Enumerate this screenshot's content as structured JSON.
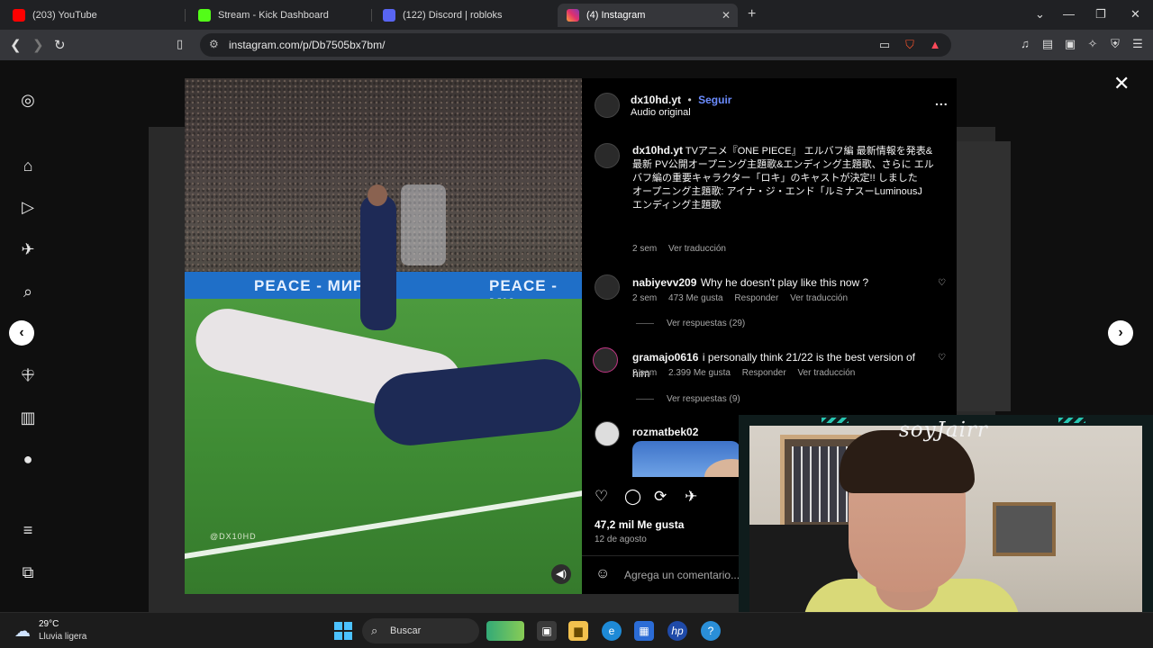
{
  "browser": {
    "tabs": [
      {
        "label": "(203) YouTube",
        "color": "#ff0000"
      },
      {
        "label": "Stream - Kick Dashboard",
        "color": "#53fc18"
      },
      {
        "label": "(122) Discord | robloks",
        "color": "#5865f2"
      },
      {
        "label": "(4) Instagram",
        "color": "#e1306c"
      }
    ],
    "url": "instagram.com/p/Db7505bx7bm/"
  },
  "post": {
    "author": "dx10hd.yt",
    "follow_label": "Seguir",
    "separator": "•",
    "audio": "Audio original",
    "more": "...",
    "caption_author": "dx10hd.yt",
    "caption_lines": [
      "TVアニメ『ONE PIECE』 エルバフ編 最新情報を発表&最新 PV公開オープニング主題歌&エンディング主題歌、さらに エルバフ編の重要キャラクター「ロキ」のキャストが決定!! しました",
      "オープニング主題歌: アイナ・ジ・エンド「ルミナスーLuminousJ",
      "エンディング主題歌"
    ],
    "caption_time": "2 sem",
    "caption_translate": "Ver traducción",
    "comments": [
      {
        "user": "nabiyevv209",
        "text": "Why he doesn't play like this now ?",
        "time": "2 sem",
        "likes": "473 Me gusta",
        "reply": "Responder",
        "translate": "Ver traducción",
        "replies": "Ver respuestas (29)"
      },
      {
        "user": "gramajo0616",
        "text": "i personally think 21/22 is the best version of him",
        "time": "2 sem",
        "likes": "2.399 Me gusta",
        "reply": "Responder",
        "translate": "Ver traducción",
        "replies": "Ver respuestas (9)"
      },
      {
        "user": "rozmatbek02"
      }
    ],
    "likes": "47,2 mil Me gusta",
    "date": "12 de agosto",
    "comment_placeholder": "Agrega un comentario..."
  },
  "video": {
    "board_left": "PEACE - МИР",
    "board_right": "PEACE - МИ",
    "watermark": "@DX10HD"
  },
  "webcam": {
    "name": "soyJairr"
  },
  "taskbar": {
    "temperature": "29°C",
    "condition": "Lluvia ligera",
    "search_label": "Buscar"
  },
  "colors": {
    "accent": "#6b8cff",
    "panel": "#000000",
    "cam_border": "#27c6b2"
  }
}
